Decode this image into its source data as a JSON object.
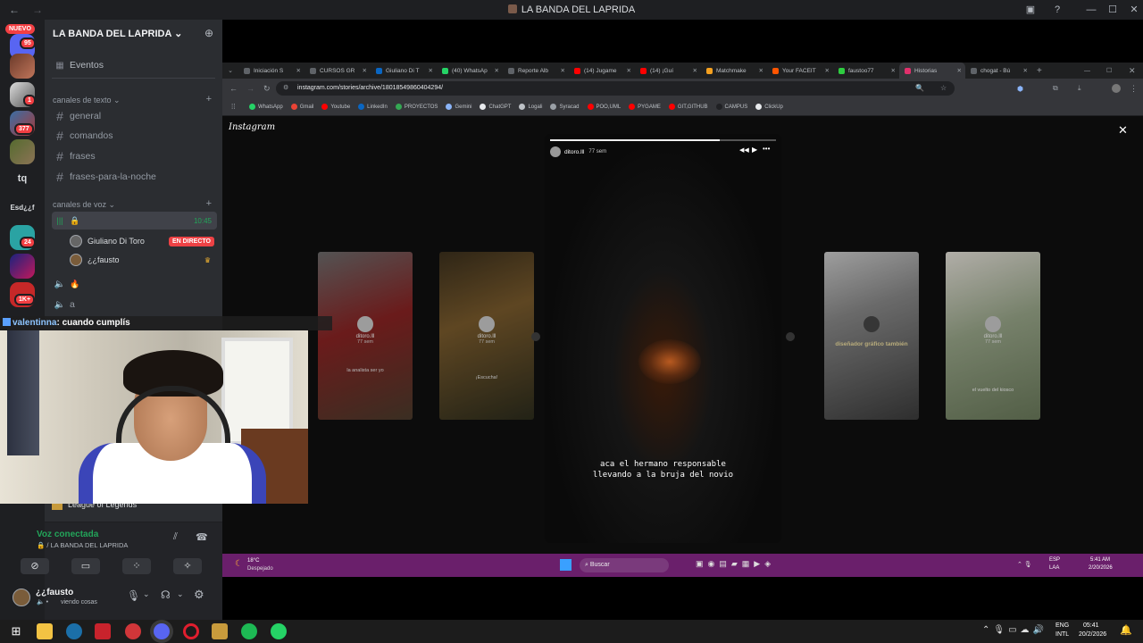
{
  "window": {
    "title": "LA BANDA DEL LAPRIDA",
    "back": "←",
    "forward": "→",
    "controls": [
      "▣",
      "?",
      "—",
      "☐",
      "✕"
    ]
  },
  "rail": {
    "new_label": "NUEVO",
    "badges": [
      "95",
      "1",
      "377",
      "24",
      "1K+"
    ],
    "text_servers": [
      "tq",
      "Esd¿¿f"
    ]
  },
  "sidebar": {
    "guild_name": "LA BANDA DEL LAPRIDA",
    "events": "Eventos",
    "text_category": "canales de texto",
    "voice_category": "canales de voz",
    "text_channels": [
      "general",
      "comandos",
      "frases",
      "frases-para-la-noche"
    ],
    "voice_time": "10:45",
    "voice_users": [
      {
        "name": "Giuliano Di Toro",
        "badge": "EN DIRECTO"
      },
      {
        "name": "¿¿fausto",
        "badge": ""
      }
    ],
    "voice_channel_a": "a",
    "voice_channel_b": "🔥",
    "activity": "League of Legends"
  },
  "chat_overlay": {
    "user": "valentinna",
    "message": ": cuando cumplís"
  },
  "voice_panel": {
    "status": "Voz conectada",
    "channel": "🔒 / LA BANDA DEL LAPRIDA"
  },
  "user_panel": {
    "name": "¿¿fausto",
    "status": "viendo cosas"
  },
  "chrome": {
    "tabs": [
      {
        "label": "Iniciación S",
        "color": "#5f6368"
      },
      {
        "label": "CURSOS GR",
        "color": "#5f6368"
      },
      {
        "label": "Giuliano Di T",
        "color": "#0a66c2"
      },
      {
        "label": "(40) WhatsAp",
        "color": "#25d366"
      },
      {
        "label": "Reporte Alb",
        "color": "#5f6368"
      },
      {
        "label": "(14) Jugame",
        "color": "#ff0000"
      },
      {
        "label": "(14) ¡Guí",
        "color": "#ff0000"
      },
      {
        "label": "Matchmake",
        "color": "#f4a020"
      },
      {
        "label": "Your FACEIT",
        "color": "#ff5500"
      },
      {
        "label": "faustoo77",
        "color": "#2ecc40"
      },
      {
        "label": "Historias",
        "color": "#e1306c"
      },
      {
        "label": "chogat - Bú",
        "color": "#5f6368"
      }
    ],
    "url": "instagram.com/stories/archive/18018549860404294/",
    "bookmarks": [
      {
        "label": "WhatsApp",
        "color": "#25d366"
      },
      {
        "label": "Gmail",
        "color": "#ea4335"
      },
      {
        "label": "Youtube",
        "color": "#ff0000"
      },
      {
        "label": "LinkedIn",
        "color": "#0a66c2"
      },
      {
        "label": "PROYECTOS",
        "color": "#34a853"
      },
      {
        "label": "Gemini",
        "color": "#8ab4f8"
      },
      {
        "label": "ChatGPT",
        "color": "#e8eaed"
      },
      {
        "label": "Logali",
        "color": "#bdc1c6"
      },
      {
        "label": "Syracad",
        "color": "#9aa0a6"
      },
      {
        "label": "POO,UML",
        "color": "#ff0000"
      },
      {
        "label": "PYGAME",
        "color": "#ff0000"
      },
      {
        "label": "GIT,GITHUB",
        "color": "#ff0000"
      },
      {
        "label": "CAMPUS",
        "color": "#202124"
      },
      {
        "label": "ClickUp",
        "color": "#e8eaed"
      }
    ]
  },
  "instagram": {
    "logo": "Instagram",
    "close": "✕",
    "main_user": "ditoro.lll",
    "main_time": "77 sem",
    "caption_line1": "aca el hermano responsable",
    "caption_line2": "llevando a la bruja del novio",
    "side_stories": [
      {
        "user": "ditoro.lll",
        "time": "77 sem",
        "caption": "la analista ser yo"
      },
      {
        "user": "ditoro.lll",
        "time": "77 sem",
        "caption": "¡Escucha!"
      },
      {
        "user": "ditoro.lll",
        "time": "77 sem",
        "caption": "diseñador gráfico también"
      },
      {
        "user": "ditoro.lll",
        "time": "77 sem",
        "caption": "el vuelto del kiosco"
      }
    ]
  },
  "inner_taskbar": {
    "temp": "18°C",
    "weather": "Despejado",
    "search": "Buscar",
    "lang": "ESP",
    "region": "LAA",
    "time": "5:41 AM",
    "date": "2/20/2026"
  },
  "taskbar": {
    "lang": "ENG",
    "region": "INTL",
    "time": "05:41",
    "date": "20/2/2026"
  }
}
